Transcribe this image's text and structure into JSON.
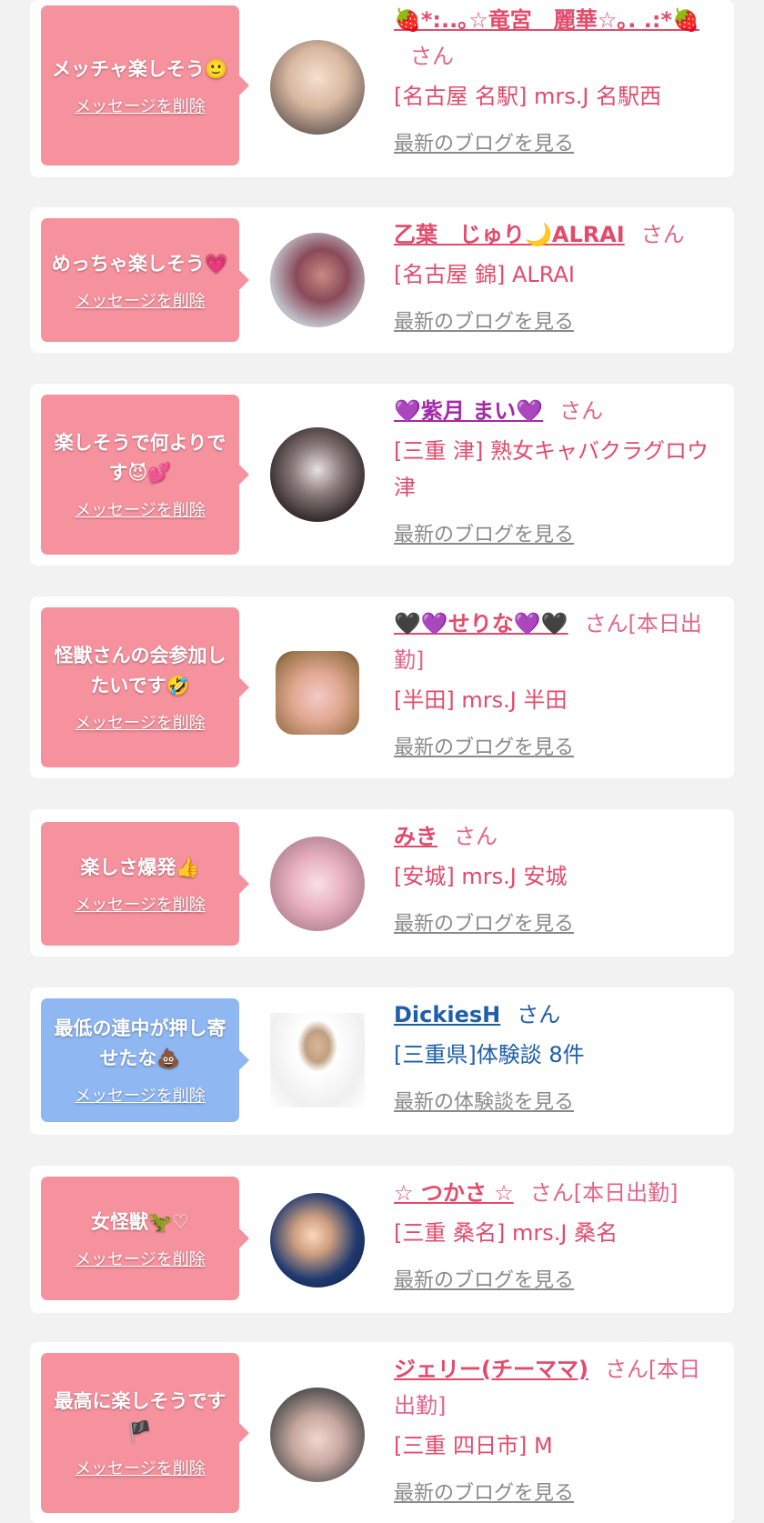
{
  "cards": [
    {
      "bubble_text": "メッチャ楽しそう🙂",
      "bubble_delete": "メッセージを削除",
      "name": "🍓*:..｡☆竜宮　麗華☆｡. .:*🍓",
      "suffix": "さん",
      "shop": "[名古屋 名駅] mrs.J 名駅西",
      "blog": "最新のブログを見る"
    },
    {
      "bubble_text": "めっちゃ楽しそう💗",
      "bubble_delete": "メッセージを削除",
      "name": "乙葉　じゅり🌙ALRAI",
      "suffix": "さん",
      "shop": "[名古屋 錦] ALRAI",
      "blog": "最新のブログを見る"
    },
    {
      "bubble_text": "楽しそうで何よりです😈💕",
      "bubble_delete": "メッセージを削除",
      "name": "💜紫月 まい💜",
      "suffix": "さん",
      "shop": "[三重 津] 熟女キャバクラグロウ津",
      "blog": "最新のブログを見る"
    },
    {
      "bubble_text": "怪獣さんの会参加したいです🤣",
      "bubble_delete": "メッセージを削除",
      "name": "🖤💜せりな💜🖤",
      "suffix": "さん[本日出勤]",
      "shop": "[半田] mrs.J 半田",
      "blog": "最新のブログを見る"
    },
    {
      "bubble_text": "楽しさ爆発👍",
      "bubble_delete": "メッセージを削除",
      "name": "みき",
      "suffix": "さん",
      "shop": "[安城] mrs.J 安城",
      "blog": "最新のブログを見る"
    },
    {
      "bubble_text": "最低の連中が押し寄せたな💩",
      "bubble_delete": "メッセージを削除",
      "name": "DickiesH",
      "suffix": "さん",
      "shop": "[三重県]体験談 8件",
      "blog": "最新の体験談を見る"
    },
    {
      "bubble_text": "女怪獣🦖♡",
      "bubble_delete": "メッセージを削除",
      "name": "☆ つかさ ☆",
      "suffix": "さん[本日出勤]",
      "shop": "[三重 桑名] mrs.J 桑名",
      "blog": "最新のブログを見る"
    },
    {
      "bubble_text": "最高に楽しそうです🏴",
      "bubble_delete": "メッセージを削除",
      "name": "ジェリー(チーママ)",
      "suffix": "さん[本日出勤]",
      "shop": "[三重 四日市] M",
      "blog": "最新のブログを見る"
    }
  ],
  "colors": {
    "pink_bubble": "#f6919e",
    "blue_bubble": "#8fb7f2",
    "name_pink": "#e24b6b",
    "name_blue": "#1f5fa8"
  }
}
